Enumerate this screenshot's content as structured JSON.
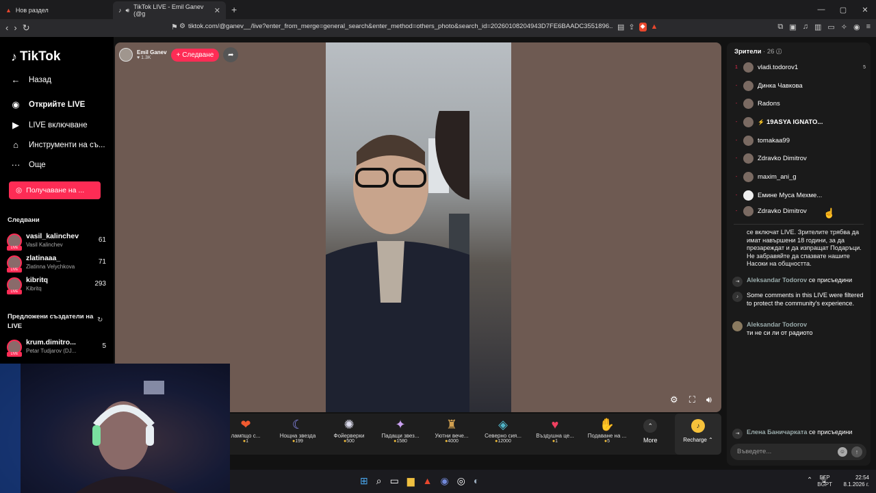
{
  "browser": {
    "tabs": [
      {
        "title": "Нов раздел"
      },
      {
        "title": "TikTok LIVE - Emil Ganev (@g"
      }
    ],
    "url": "tiktok.com/@ganev__/live?enter_from_merge=general_search&enter_method=others_photo&search_id=20260108204943D7FE6BAADC3551896..."
  },
  "sidebar": {
    "logo": "TikTok",
    "back": "Назад",
    "discover": "Открийте LIVE",
    "go_live": "LIVE включване",
    "tools": "Инструменти на съ...",
    "more": "Още",
    "get_button": "Получаване на ...",
    "following_title": "Следвани",
    "following": [
      {
        "name": "vasil_kalinchev",
        "sub": "Vasil Kalinchev",
        "count": "61"
      },
      {
        "name": "zlatinaaa_",
        "sub": "Zlatinna Velychkova",
        "count": "71"
      },
      {
        "name": "kibritq",
        "sub": "Kibritq",
        "count": "293"
      }
    ],
    "suggested_title": "Предложени създатели на LIVE",
    "suggested": [
      {
        "name": "krum.dimitro...",
        "sub": "Petar Tudjarov (DJ...",
        "count": "5"
      }
    ]
  },
  "live": {
    "host_name": "Emil Ganev",
    "host_likes": "1.3K",
    "follow_label": "+ Следване"
  },
  "gifts": [
    {
      "name": "лампщо с...",
      "price": "1",
      "icon": "❤"
    },
    {
      "name": "Нощна звезда",
      "price": "199",
      "icon": "☾"
    },
    {
      "name": "Фойерверки",
      "price": "500",
      "icon": "✺"
    },
    {
      "name": "Падащи звез...",
      "price": "1580",
      "icon": "✦"
    },
    {
      "name": "Уютни вече...",
      "price": "4000",
      "icon": "♜"
    },
    {
      "name": "Северно сия...",
      "price": "12000",
      "icon": "◈"
    },
    {
      "name": "Въздушна це...",
      "price": "1",
      "icon": "♥"
    },
    {
      "name": "Подаване на ...",
      "price": "5",
      "icon": "✋"
    }
  ],
  "more_label": "More",
  "recharge_label": "Recharge",
  "viewers": {
    "title": "Зрители",
    "count": "· 26",
    "list": [
      {
        "rank": "1",
        "name": "vladi.todorov1",
        "score": "5"
      },
      {
        "rank": "-",
        "name": "Динка Чавкова",
        "score": ""
      },
      {
        "rank": "-",
        "name": "Radons",
        "score": ""
      },
      {
        "rank": "-",
        "name": "19ASYA IGNATO...",
        "score": ""
      },
      {
        "rank": "-",
        "name": "tomakaa99",
        "score": ""
      },
      {
        "rank": "-",
        "name": "Zdravko Dimitrov",
        "score": ""
      },
      {
        "rank": "-",
        "name": "maxim_ani_g",
        "score": ""
      },
      {
        "rank": "-",
        "name": "Емине Муса Мехме...",
        "score": ""
      },
      {
        "rank": "-",
        "name": "Zdravko Dimitrov",
        "score": ""
      }
    ]
  },
  "chat": {
    "rules": "се включат LIVE. Зрителите трябва да имат навършени 18 години, за да презареждат и да изпращат Подаръци. Не забравяйте да спазвате нашите Насоки на общността.",
    "joined1_name": "Aleksandar Todorov",
    "joined1_text": "се присъедини",
    "system_msg": "Some comments in this LIVE were filtered to protect the community's experience.",
    "msg_name": "Aleksandar Todorov",
    "msg_text": "ти не си ли от радиото",
    "joined2_name": "Елена Баничарката",
    "joined2_text": "се присъедини",
    "input_placeholder": "Въведете..."
  },
  "taskbar": {
    "lang1": "БГР",
    "lang2": "BGPT",
    "time": "22:54",
    "date": "8.1.2026 г."
  }
}
